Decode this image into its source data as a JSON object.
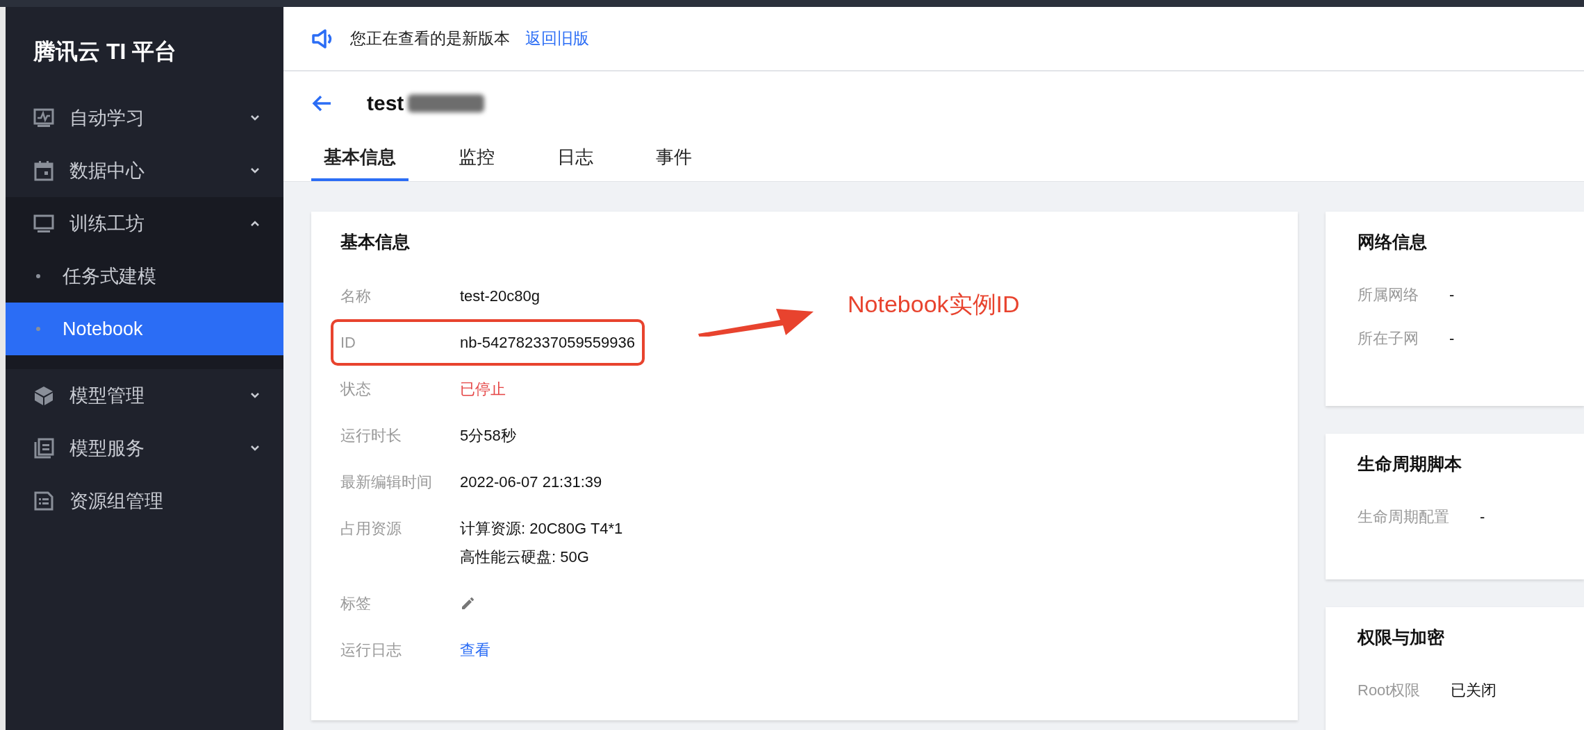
{
  "sidebar": {
    "title": "腾讯云 TI 平台",
    "items": [
      {
        "label": "自动学习",
        "selected": false,
        "expanded": false
      },
      {
        "label": "数据中心",
        "selected": false,
        "expanded": false
      },
      {
        "label": "训练工坊",
        "selected": false,
        "expanded": true,
        "children": [
          {
            "label": "任务式建模",
            "selected": false
          },
          {
            "label": "Notebook",
            "selected": true
          }
        ]
      },
      {
        "label": "模型管理",
        "selected": false,
        "expanded": false
      },
      {
        "label": "模型服务",
        "selected": false,
        "expanded": false
      },
      {
        "label": "资源组管理",
        "selected": false
      }
    ]
  },
  "notice": {
    "text": "您正在查看的是新版本",
    "link": "返回旧版"
  },
  "header": {
    "title": "test",
    "tabs": [
      {
        "label": "基本信息",
        "selected": true
      },
      {
        "label": "监控",
        "selected": false
      },
      {
        "label": "日志",
        "selected": false
      },
      {
        "label": "事件",
        "selected": false
      }
    ]
  },
  "basic_info": {
    "title": "基本信息",
    "fields": [
      {
        "label": "名称",
        "value": "test-20c80g"
      },
      {
        "label": "ID",
        "value": "nb-542782337059559936",
        "highlighted": true
      },
      {
        "label": "状态",
        "value": "已停止",
        "kind": "status"
      },
      {
        "label": "运行时长",
        "value": "5分58秒"
      },
      {
        "label": "最新编辑时间",
        "value": "2022-06-07 21:31:39"
      },
      {
        "label": "占用资源",
        "lines": [
          "计算资源: 20C80G T4*1",
          "高性能云硬盘: 50G"
        ],
        "kind": "lines"
      },
      {
        "label": "标签",
        "kind": "edit"
      },
      {
        "label": "运行日志",
        "value": "查看",
        "kind": "link"
      }
    ]
  },
  "annotation": {
    "text": "Notebook实例ID"
  },
  "side_cards": [
    {
      "title": "网络信息",
      "fields": [
        {
          "label": "所属网络",
          "value": "-"
        },
        {
          "label": "所在子网",
          "value": "-"
        }
      ]
    },
    {
      "title": "生命周期脚本",
      "fields": [
        {
          "label": "生命周期配置",
          "value": "-"
        }
      ]
    },
    {
      "title": "权限与加密",
      "fields": [
        {
          "label": "Root权限",
          "value": "已关闭"
        }
      ]
    }
  ]
}
